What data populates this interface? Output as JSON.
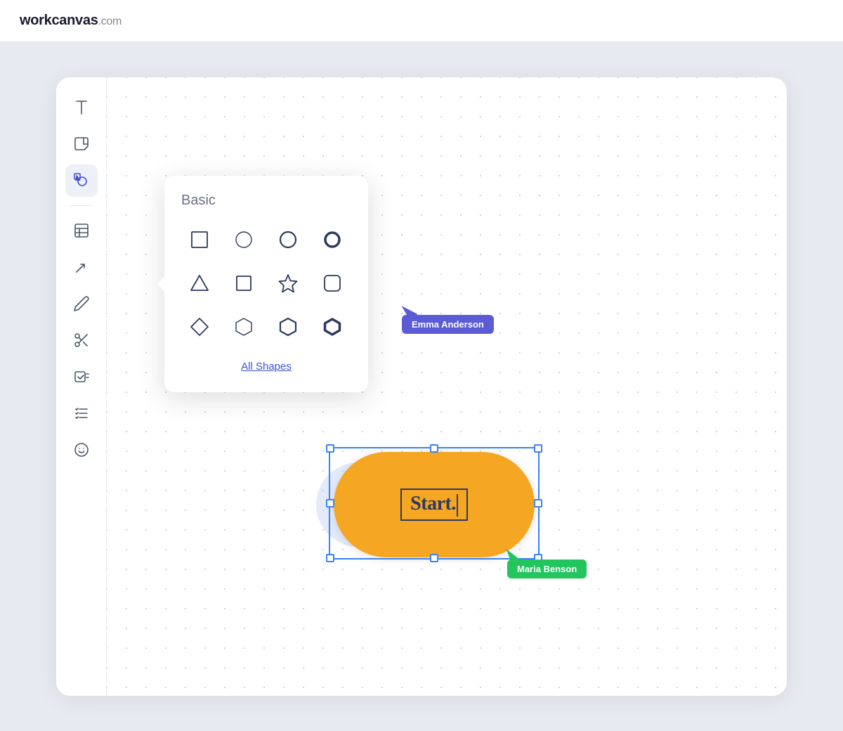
{
  "app": {
    "logo_work": "work",
    "logo_canvas": "canvas",
    "logo_dotcom": ".com"
  },
  "popup": {
    "title": "Basic",
    "all_shapes_label": "All Shapes",
    "shapes": [
      {
        "name": "square",
        "row": 0,
        "col": 0
      },
      {
        "name": "circle-thin",
        "row": 0,
        "col": 1
      },
      {
        "name": "circle-medium",
        "row": 0,
        "col": 2
      },
      {
        "name": "circle-thick",
        "row": 0,
        "col": 3
      },
      {
        "name": "triangle",
        "row": 1,
        "col": 0
      },
      {
        "name": "square-small",
        "row": 1,
        "col": 1
      },
      {
        "name": "star",
        "row": 1,
        "col": 2
      },
      {
        "name": "square-rounded",
        "row": 1,
        "col": 3
      },
      {
        "name": "diamond",
        "row": 2,
        "col": 0
      },
      {
        "name": "hexagon-thin",
        "row": 2,
        "col": 1
      },
      {
        "name": "hexagon-medium",
        "row": 2,
        "col": 2
      },
      {
        "name": "hexagon-thick",
        "row": 2,
        "col": 3
      }
    ]
  },
  "cursors": {
    "emma": {
      "name": "Emma Anderson",
      "color": "#5b5bd6"
    },
    "maria": {
      "name": "Maria Benson",
      "color": "#22c55e"
    }
  },
  "canvas_element": {
    "start_text": "Start.",
    "cursor_text": "|"
  },
  "sidebar_tools": [
    {
      "name": "text-tool",
      "label": "Text"
    },
    {
      "name": "sticky-note-tool",
      "label": "Sticky Note"
    },
    {
      "name": "shapes-tool",
      "label": "Shapes",
      "active": true
    },
    {
      "name": "table-tool",
      "label": "Table"
    },
    {
      "name": "connector-tool",
      "label": "Connector"
    },
    {
      "name": "pen-tool",
      "label": "Pen"
    },
    {
      "name": "cut-tool",
      "label": "Cut"
    },
    {
      "name": "checkbox-tool",
      "label": "Checklist"
    },
    {
      "name": "tasks-tool",
      "label": "Tasks"
    },
    {
      "name": "emoji-tool",
      "label": "Emoji"
    }
  ]
}
